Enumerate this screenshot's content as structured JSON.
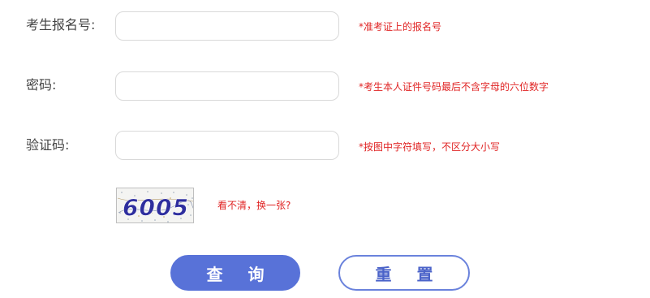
{
  "form": {
    "exam_number": {
      "label": "考生报名号:",
      "value": "",
      "placeholder": "",
      "hint": "*准考证上的报名号"
    },
    "password": {
      "label": "密码:",
      "value": "",
      "placeholder": "",
      "hint": "*考生本人证件号码最后不含字母的六位数字"
    },
    "captcha": {
      "label": "验证码:",
      "value": "",
      "placeholder": "",
      "hint": "*按图中字符填写，不区分大小写",
      "image_text": "6005",
      "refresh_text": "看不清，换一张?"
    }
  },
  "buttons": {
    "query": "查 询",
    "reset": "重 置"
  },
  "colors": {
    "accent": "#5872d8",
    "hint_red": "#e02424",
    "captcha_text": "#2e2e9e"
  }
}
